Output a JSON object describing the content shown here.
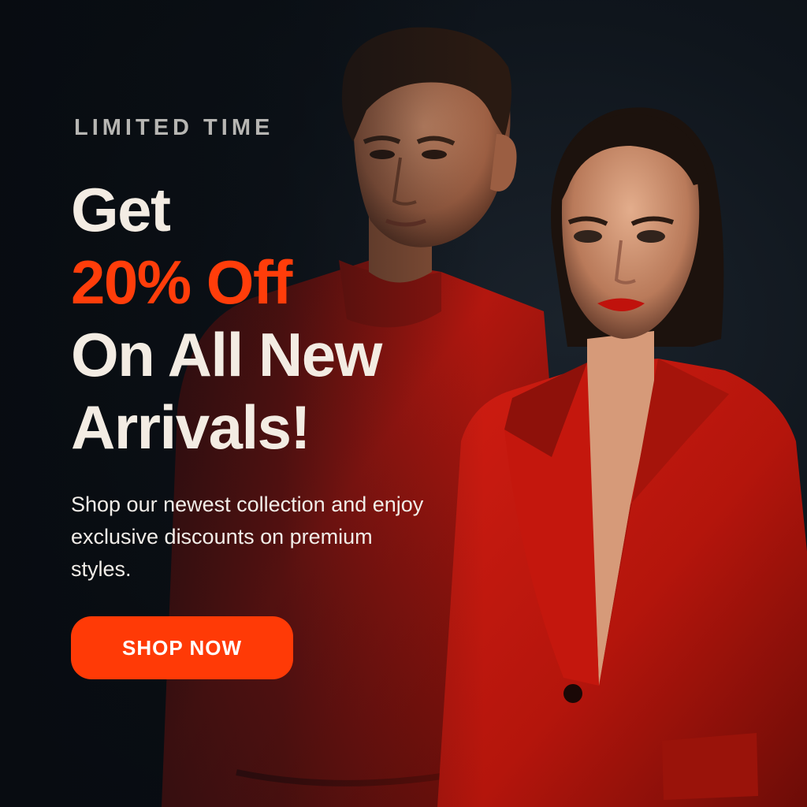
{
  "promo": {
    "eyebrow": "LIMITED TIME",
    "headline_line1": "Get",
    "headline_accent": "20% Off",
    "headline_line3": "On All New",
    "headline_line4": "Arrivals!",
    "body": "Shop our newest collection and enjoy exclusive discounts on premium styles.",
    "cta_label": "SHOP NOW"
  },
  "colors": {
    "background": "#0b1017",
    "accent": "#ff3d0a",
    "button": "#ff3a06",
    "garment": "#c8170e",
    "text": "#f3ece3"
  }
}
